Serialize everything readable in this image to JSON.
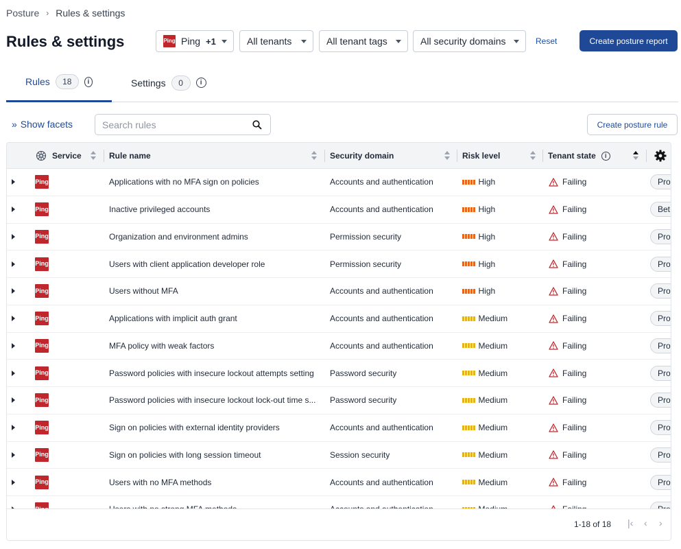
{
  "breadcrumb": {
    "root": "Posture",
    "separator": "›",
    "current": "Rules & settings"
  },
  "page_title": "Rules & settings",
  "filters": {
    "service": {
      "label": "Ping",
      "extra": "+1"
    },
    "tenants": "All tenants",
    "tenant_tags": "All tenant tags",
    "security_domains": "All security domains"
  },
  "reset_label": "Reset",
  "create_report_label": "Create posture report",
  "tabs": [
    {
      "label": "Rules",
      "count": "18"
    },
    {
      "label": "Settings",
      "count": "0"
    }
  ],
  "show_facets_label": "Show facets",
  "search": {
    "placeholder": "Search rules",
    "value": ""
  },
  "create_rule_label": "Create posture rule",
  "logo_text": "Ping",
  "table": {
    "columns": {
      "service": "Service",
      "rule_name": "Rule name",
      "security_domain": "Security domain",
      "risk_level": "Risk level",
      "tenant_state": "Tenant state"
    },
    "rows": [
      {
        "rule": "Applications with no MFA sign on policies",
        "domain": "Accounts and authentication",
        "risk": "High",
        "state": "Failing",
        "extra": "Pro"
      },
      {
        "rule": "Inactive privileged accounts",
        "domain": "Accounts and authentication",
        "risk": "High",
        "state": "Failing",
        "extra": "Bet"
      },
      {
        "rule": "Organization and environment admins",
        "domain": "Permission security",
        "risk": "High",
        "state": "Failing",
        "extra": "Pro"
      },
      {
        "rule": "Users with client application developer role",
        "domain": "Permission security",
        "risk": "High",
        "state": "Failing",
        "extra": "Pro"
      },
      {
        "rule": "Users without MFA",
        "domain": "Accounts and authentication",
        "risk": "High",
        "state": "Failing",
        "extra": "Pro"
      },
      {
        "rule": "Applications with implicit auth grant",
        "domain": "Accounts and authentication",
        "risk": "Medium",
        "state": "Failing",
        "extra": "Pro"
      },
      {
        "rule": "MFA policy with weak factors",
        "domain": "Accounts and authentication",
        "risk": "Medium",
        "state": "Failing",
        "extra": "Pro"
      },
      {
        "rule": "Password policies with insecure lockout attempts setting",
        "domain": "Password security",
        "risk": "Medium",
        "state": "Failing",
        "extra": "Pro"
      },
      {
        "rule": "Password policies with insecure lockout lock-out time s...",
        "domain": "Password security",
        "risk": "Medium",
        "state": "Failing",
        "extra": "Pro"
      },
      {
        "rule": "Sign on policies with external identity providers",
        "domain": "Accounts and authentication",
        "risk": "Medium",
        "state": "Failing",
        "extra": "Pro"
      },
      {
        "rule": "Sign on policies with long session timeout",
        "domain": "Session security",
        "risk": "Medium",
        "state": "Failing",
        "extra": "Pro"
      },
      {
        "rule": "Users with no MFA methods",
        "domain": "Accounts and authentication",
        "risk": "Medium",
        "state": "Failing",
        "extra": "Pro"
      },
      {
        "rule": "Users with no strong MFA methods",
        "domain": "Accounts and authentication",
        "risk": "Medium",
        "state": "Failing",
        "extra": "Pro"
      }
    ]
  },
  "pagination": {
    "label": "1-18 of 18"
  },
  "colors": {
    "primary": "#1f4997",
    "risk_high": "#e8661c",
    "risk_medium": "#e3b21c",
    "failing": "#c0272d",
    "ping_brand": "#c0272d"
  }
}
